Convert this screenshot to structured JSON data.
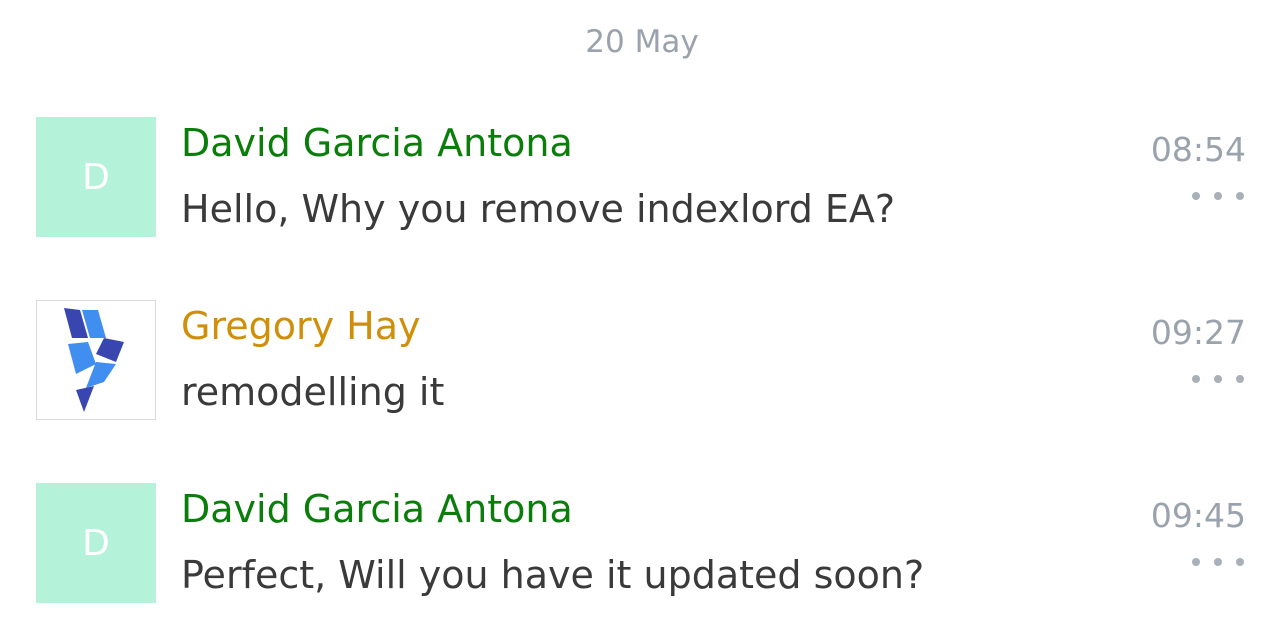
{
  "date_separator": "20 May",
  "messages": [
    {
      "author": "David Garcia Antona",
      "avatar_letter": "D",
      "text": "Hello, Why you remove indexlord EA?",
      "time": "08:54",
      "more_icon": "ellipsis-icon"
    },
    {
      "author": "Gregory Hay",
      "avatar_icon": "indexlord-logo",
      "text": "remodelling it",
      "time": "09:27",
      "more_icon": "ellipsis-icon"
    },
    {
      "author": "David Garcia Antona",
      "avatar_letter": "D",
      "text": "Perfect, Will you have it updated soon?",
      "time": "09:45",
      "more_icon": "ellipsis-icon"
    }
  ],
  "colors": {
    "author_primary": "#0a7d0a",
    "author_secondary": "#d08f08",
    "avatar_letter_bg": "#b4f2d9",
    "muted_text": "#9aa3ad",
    "message_text": "#3a3a3a"
  }
}
